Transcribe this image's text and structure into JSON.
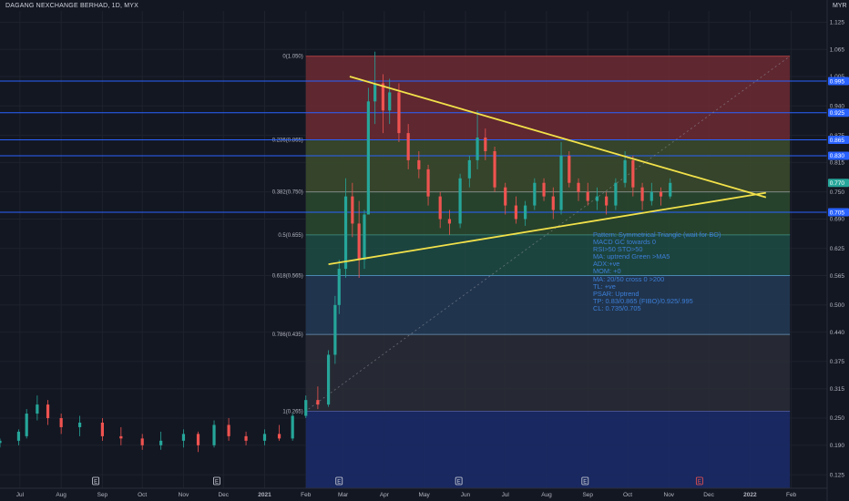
{
  "header": {
    "symbol": "DAGANG NEXCHANGE BERHAD, 1D, MYX",
    "currency": "MYR"
  },
  "chart_data": {
    "type": "candlestick",
    "price_axis": {
      "ticks": [
        "1.125",
        "1.065",
        "1.005",
        "0.940",
        "0.875",
        "0.815",
        "0.750",
        "0.690",
        "0.625",
        "0.565",
        "0.500",
        "0.440",
        "0.375",
        "0.315",
        "0.250",
        "0.190",
        "0.125"
      ],
      "range": [
        0.095,
        1.15
      ]
    },
    "time_axis": {
      "ticks": [
        "Jul",
        "Aug",
        "Sep",
        "Oct",
        "Nov",
        "Dec",
        "2021",
        "Feb",
        "Mar",
        "Apr",
        "May",
        "Jun",
        "Jul",
        "Aug",
        "Sep",
        "Oct",
        "Nov",
        "Dec",
        "2022",
        "Feb"
      ],
      "range": [
        "2020-06-16",
        "2022-02-28"
      ]
    },
    "candles": [
      {
        "t": "2020-06-16",
        "o": 0.195,
        "h": 0.205,
        "l": 0.185,
        "c": 0.2
      },
      {
        "t": "2020-06-30",
        "o": 0.2,
        "h": 0.225,
        "l": 0.19,
        "c": 0.22
      },
      {
        "t": "2020-07-06",
        "o": 0.21,
        "h": 0.27,
        "l": 0.205,
        "c": 0.26
      },
      {
        "t": "2020-07-14",
        "o": 0.26,
        "h": 0.3,
        "l": 0.245,
        "c": 0.28
      },
      {
        "t": "2020-07-22",
        "o": 0.28,
        "h": 0.29,
        "l": 0.235,
        "c": 0.25
      },
      {
        "t": "2020-08-01",
        "o": 0.25,
        "h": 0.26,
        "l": 0.215,
        "c": 0.23
      },
      {
        "t": "2020-08-15",
        "o": 0.23,
        "h": 0.255,
        "l": 0.21,
        "c": 0.24
      },
      {
        "t": "2020-09-01",
        "o": 0.24,
        "h": 0.25,
        "l": 0.2,
        "c": 0.21
      },
      {
        "t": "2020-09-15",
        "o": 0.21,
        "h": 0.23,
        "l": 0.19,
        "c": 0.205
      },
      {
        "t": "2020-10-01",
        "o": 0.205,
        "h": 0.215,
        "l": 0.18,
        "c": 0.19
      },
      {
        "t": "2020-10-15",
        "o": 0.19,
        "h": 0.22,
        "l": 0.18,
        "c": 0.2
      },
      {
        "t": "2020-11-01",
        "o": 0.2,
        "h": 0.225,
        "l": 0.185,
        "c": 0.215
      },
      {
        "t": "2020-11-12",
        "o": 0.215,
        "h": 0.22,
        "l": 0.175,
        "c": 0.19
      },
      {
        "t": "2020-11-24",
        "o": 0.19,
        "h": 0.245,
        "l": 0.185,
        "c": 0.235
      },
      {
        "t": "2020-12-05",
        "o": 0.235,
        "h": 0.25,
        "l": 0.2,
        "c": 0.21
      },
      {
        "t": "2020-12-18",
        "o": 0.21,
        "h": 0.22,
        "l": 0.19,
        "c": 0.2
      },
      {
        "t": "2021-01-01",
        "o": 0.2,
        "h": 0.225,
        "l": 0.19,
        "c": 0.215
      },
      {
        "t": "2021-01-12",
        "o": 0.215,
        "h": 0.235,
        "l": 0.2,
        "c": 0.205
      },
      {
        "t": "2021-01-22",
        "o": 0.205,
        "h": 0.26,
        "l": 0.2,
        "c": 0.255
      },
      {
        "t": "2021-02-01",
        "o": 0.255,
        "h": 0.3,
        "l": 0.25,
        "c": 0.29
      },
      {
        "t": "2021-02-10",
        "o": 0.29,
        "h": 0.32,
        "l": 0.27,
        "c": 0.28
      },
      {
        "t": "2021-02-18",
        "o": 0.28,
        "h": 0.4,
        "l": 0.275,
        "c": 0.39
      },
      {
        "t": "2021-02-23",
        "o": 0.39,
        "h": 0.52,
        "l": 0.37,
        "c": 0.5
      },
      {
        "t": "2021-02-26",
        "o": 0.5,
        "h": 0.6,
        "l": 0.48,
        "c": 0.58
      },
      {
        "t": "2021-03-03",
        "o": 0.58,
        "h": 0.78,
        "l": 0.56,
        "c": 0.74
      },
      {
        "t": "2021-03-08",
        "o": 0.74,
        "h": 0.77,
        "l": 0.65,
        "c": 0.68
      },
      {
        "t": "2021-03-13",
        "o": 0.68,
        "h": 0.73,
        "l": 0.56,
        "c": 0.6
      },
      {
        "t": "2021-03-17",
        "o": 0.6,
        "h": 0.71,
        "l": 0.58,
        "c": 0.7
      },
      {
        "t": "2021-03-20",
        "o": 0.7,
        "h": 0.98,
        "l": 0.7,
        "c": 0.95
      },
      {
        "t": "2021-03-25",
        "o": 0.95,
        "h": 1.06,
        "l": 0.9,
        "c": 0.99
      },
      {
        "t": "2021-03-31",
        "o": 0.99,
        "h": 1.01,
        "l": 0.88,
        "c": 0.93
      },
      {
        "t": "2021-04-05",
        "o": 0.93,
        "h": 1.0,
        "l": 0.9,
        "c": 0.97
      },
      {
        "t": "2021-04-12",
        "o": 0.97,
        "h": 0.99,
        "l": 0.86,
        "c": 0.88
      },
      {
        "t": "2021-04-19",
        "o": 0.88,
        "h": 0.9,
        "l": 0.8,
        "c": 0.82
      },
      {
        "t": "2021-04-27",
        "o": 0.82,
        "h": 0.84,
        "l": 0.78,
        "c": 0.8
      },
      {
        "t": "2021-05-04",
        "o": 0.8,
        "h": 0.81,
        "l": 0.72,
        "c": 0.74
      },
      {
        "t": "2021-05-13",
        "o": 0.74,
        "h": 0.75,
        "l": 0.67,
        "c": 0.69
      },
      {
        "t": "2021-05-20",
        "o": 0.69,
        "h": 0.71,
        "l": 0.655,
        "c": 0.68
      },
      {
        "t": "2021-05-28",
        "o": 0.68,
        "h": 0.79,
        "l": 0.67,
        "c": 0.78
      },
      {
        "t": "2021-06-04",
        "o": 0.78,
        "h": 0.83,
        "l": 0.76,
        "c": 0.82
      },
      {
        "t": "2021-06-10",
        "o": 0.82,
        "h": 0.93,
        "l": 0.8,
        "c": 0.87
      },
      {
        "t": "2021-06-16",
        "o": 0.87,
        "h": 0.89,
        "l": 0.82,
        "c": 0.84
      },
      {
        "t": "2021-06-23",
        "o": 0.84,
        "h": 0.85,
        "l": 0.75,
        "c": 0.76
      },
      {
        "t": "2021-07-01",
        "o": 0.76,
        "h": 0.77,
        "l": 0.7,
        "c": 0.72
      },
      {
        "t": "2021-07-09",
        "o": 0.72,
        "h": 0.74,
        "l": 0.68,
        "c": 0.69
      },
      {
        "t": "2021-07-16",
        "o": 0.69,
        "h": 0.73,
        "l": 0.675,
        "c": 0.72
      },
      {
        "t": "2021-07-23",
        "o": 0.72,
        "h": 0.78,
        "l": 0.71,
        "c": 0.77
      },
      {
        "t": "2021-07-30",
        "o": 0.77,
        "h": 0.78,
        "l": 0.73,
        "c": 0.74
      },
      {
        "t": "2021-08-06",
        "o": 0.74,
        "h": 0.76,
        "l": 0.69,
        "c": 0.71
      },
      {
        "t": "2021-08-12",
        "o": 0.71,
        "h": 0.86,
        "l": 0.7,
        "c": 0.83
      },
      {
        "t": "2021-08-18",
        "o": 0.83,
        "h": 0.84,
        "l": 0.76,
        "c": 0.77
      },
      {
        "t": "2021-08-25",
        "o": 0.77,
        "h": 0.78,
        "l": 0.73,
        "c": 0.75
      },
      {
        "t": "2021-09-01",
        "o": 0.75,
        "h": 0.77,
        "l": 0.72,
        "c": 0.73
      },
      {
        "t": "2021-09-08",
        "o": 0.73,
        "h": 0.76,
        "l": 0.71,
        "c": 0.74
      },
      {
        "t": "2021-09-15",
        "o": 0.74,
        "h": 0.75,
        "l": 0.7,
        "c": 0.72
      },
      {
        "t": "2021-09-22",
        "o": 0.72,
        "h": 0.78,
        "l": 0.71,
        "c": 0.77
      },
      {
        "t": "2021-09-29",
        "o": 0.77,
        "h": 0.84,
        "l": 0.76,
        "c": 0.82
      },
      {
        "t": "2021-10-05",
        "o": 0.82,
        "h": 0.83,
        "l": 0.74,
        "c": 0.76
      },
      {
        "t": "2021-10-12",
        "o": 0.76,
        "h": 0.77,
        "l": 0.71,
        "c": 0.73
      },
      {
        "t": "2021-10-19",
        "o": 0.73,
        "h": 0.77,
        "l": 0.72,
        "c": 0.75
      },
      {
        "t": "2021-10-26",
        "o": 0.75,
        "h": 0.76,
        "l": 0.72,
        "c": 0.74
      },
      {
        "t": "2021-11-02",
        "o": 0.74,
        "h": 0.78,
        "l": 0.735,
        "c": 0.77
      }
    ],
    "fib_levels": [
      {
        "label": "0(1.050)",
        "value": 1.05,
        "fill": "#6d2a33"
      },
      {
        "label": "0.236(0.865)",
        "value": 0.865,
        "fill": "#3c4c2c"
      },
      {
        "label": "0.382(0.750)",
        "value": 0.75,
        "fill": "#2b4a2e"
      },
      {
        "label": "0.5(0.655)",
        "value": 0.655,
        "fill": "#1e4c44"
      },
      {
        "label": "0.618(0.565)",
        "value": 0.565,
        "fill": "#233a55"
      },
      {
        "label": "0.786(0.435)",
        "value": 0.435,
        "fill": "#2a2d36"
      },
      {
        "label": "1(0.265)",
        "value": 0.265,
        "fill": "#1b2c6b"
      }
    ],
    "fib_range": {
      "start": "2021-02-01",
      "end": "2022-01-31",
      "bottom": 0.095
    },
    "horizontal_lines": [
      0.995,
      0.925,
      0.865,
      0.83,
      0.705
    ],
    "trendlines": [
      {
        "from": {
          "t": "2021-03-06",
          "v": 1.005
        },
        "to": {
          "t": "2022-01-13",
          "v": 0.738
        },
        "color": "#f2e14a"
      },
      {
        "from": {
          "t": "2021-02-18",
          "v": 0.59
        },
        "to": {
          "t": "2022-01-13",
          "v": 0.748
        },
        "color": "#f2e14a"
      }
    ],
    "projection_line": {
      "from": {
        "t": "2021-02-03",
        "v": 0.27
      },
      "to": {
        "t": "2022-01-31",
        "v": 1.05
      }
    },
    "price_tags": [
      {
        "text": "0.995",
        "value": 0.995,
        "color": "#2962ff"
      },
      {
        "text": "0.925",
        "value": 0.925,
        "color": "#2962ff"
      },
      {
        "text": "0.865",
        "value": 0.865,
        "color": "#2962ff"
      },
      {
        "text": "0.830",
        "value": 0.83,
        "color": "#2962ff"
      },
      {
        "text": "0.770",
        "value": 0.77,
        "color": "#26a69a"
      },
      {
        "text": "0.705",
        "value": 0.705,
        "color": "#2962ff"
      }
    ],
    "earnings_markers": [
      {
        "t": "2020-08-27",
        "label": "E",
        "color": "#d1d4dc"
      },
      {
        "t": "2020-11-26",
        "label": "E",
        "color": "#d1d4dc"
      },
      {
        "t": "2021-02-26",
        "label": "E",
        "color": "#d1d4dc"
      },
      {
        "t": "2021-05-27",
        "label": "E",
        "color": "#d1d4dc"
      },
      {
        "t": "2021-08-30",
        "label": "E",
        "color": "#d1d4dc"
      },
      {
        "t": "2021-11-24",
        "label": "E",
        "color": "#ef5350"
      }
    ]
  },
  "annotation": {
    "lines": [
      "Pattern: Symmetrical Triangle (wait for BO)",
      "MACD GC towards 0",
      "RSI>50 STO>50",
      "MA: uptrend Green >MA5",
      "ADX:+ve",
      "MOM: +0",
      "MA: 20/50 cross 0 >200",
      "TL: +ve",
      "PSAR: Uptrend",
      "",
      "TP: 0.83/0.865 (FIBO)/0.925/.995",
      "CL: 0.735/0.705"
    ]
  }
}
